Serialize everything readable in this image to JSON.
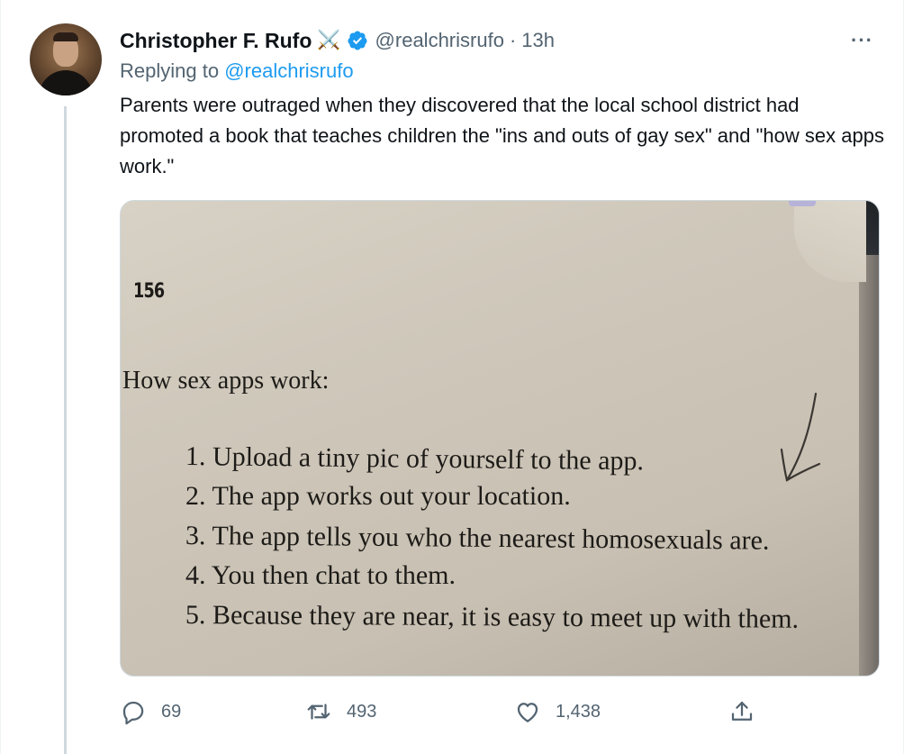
{
  "tweet": {
    "author_name": "Christopher F. Rufo",
    "author_emoji": "⚔️",
    "handle": "@realchrisrufo",
    "separator": "·",
    "time": "13h",
    "more_label": "···",
    "replying_prefix": "Replying to",
    "replying_handle": "@realchrisrufo",
    "text": "Parents were outraged when they discovered that the local school district had promoted a book that teaches children the \"ins and outs of gay sex\" and \"how sex apps work.\""
  },
  "media": {
    "page_number": "156",
    "heading": "How sex apps work:",
    "list": [
      "1. Upload a tiny pic of yourself to the app.",
      "2. The app works out your location.",
      "3. The app tells you who the nearest homosexuals are.",
      "4. You then chat to them.",
      "5. Because they are near, it is easy to meet up with them."
    ]
  },
  "actions": {
    "reply_count": "69",
    "retweet_count": "493",
    "like_count": "1,438"
  },
  "colors": {
    "accent": "#1d9bf0",
    "secondary_text": "#536471",
    "primary_text": "#0f1419",
    "thread_line": "#cfd9de"
  },
  "icons": {
    "verified": "verified-badge-icon",
    "reply": "reply-icon",
    "retweet": "retweet-icon",
    "like": "heart-icon",
    "share": "share-icon",
    "more": "more-icon"
  }
}
